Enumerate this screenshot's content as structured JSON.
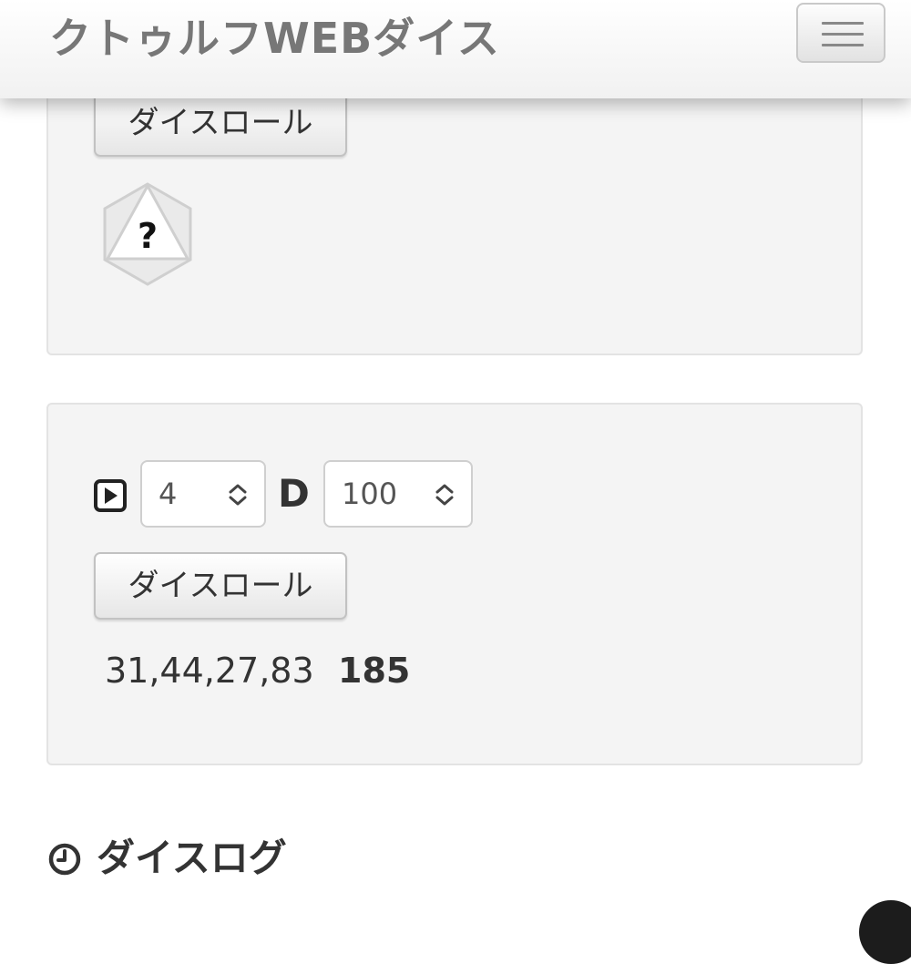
{
  "header": {
    "title": "クトゥルフWEBダイス",
    "menu_icon": "hamburger-menu-icon"
  },
  "panel1": {
    "roll_button_label": "ダイスロール",
    "die_face_text": "?",
    "die_icon": "d20-dice-icon"
  },
  "panel2": {
    "play_icon": "play-square-icon",
    "count_value": "4",
    "separator": "D",
    "sides_value": "100",
    "roll_button_label": "ダイスロール",
    "results_text": "31,44,27,83",
    "total_text": "185"
  },
  "log": {
    "heading": "ダイスログ",
    "icon": "clock-icon"
  },
  "colors": {
    "panel_bg": "#f4f4f4",
    "text": "#333333",
    "brand": "#777777"
  }
}
